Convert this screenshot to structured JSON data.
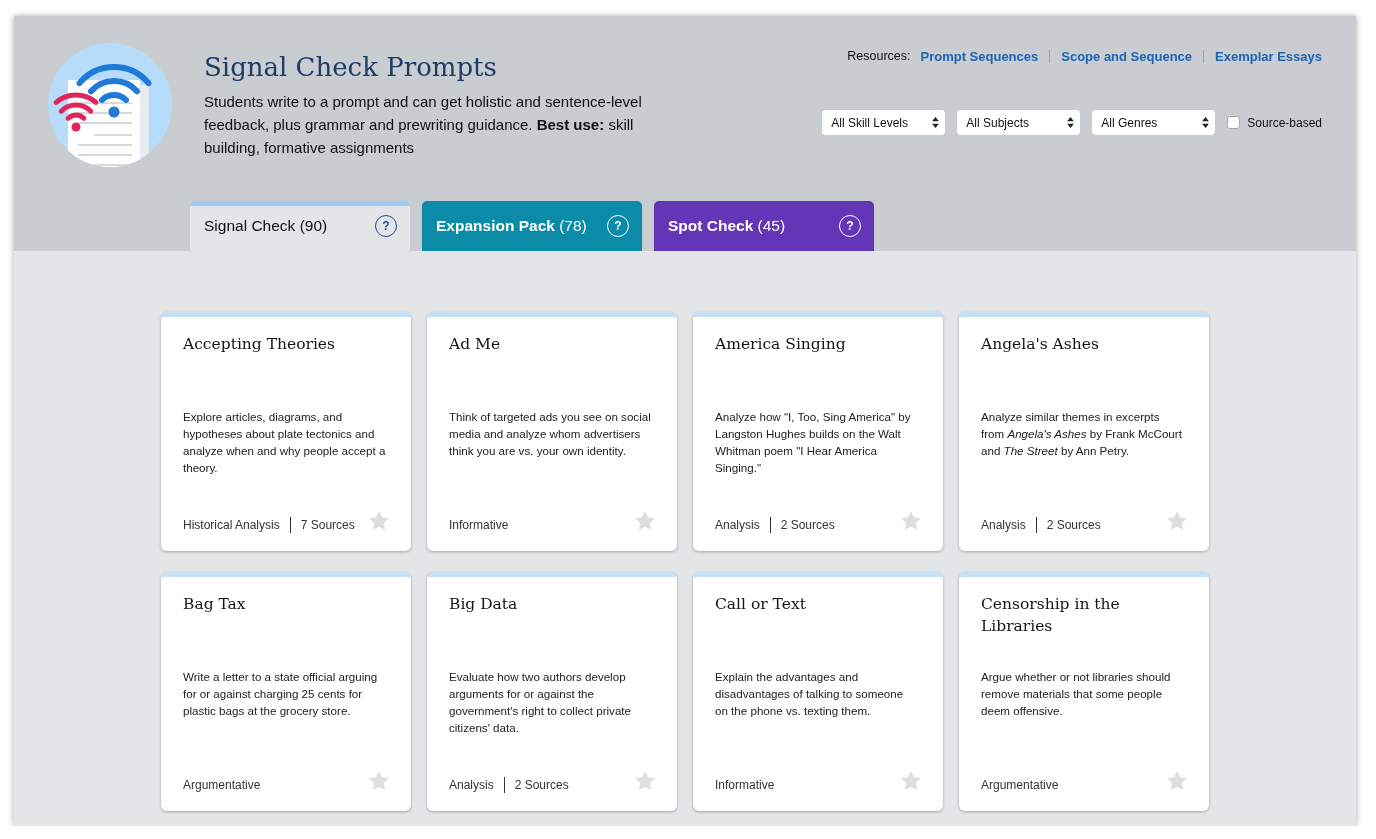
{
  "header": {
    "title": "Signal Check Prompts",
    "description": "Students write to a prompt and can get holistic and sentence-level feedback, plus grammar and prewriting guidance. **Best use:** skill building, formative assignments"
  },
  "resources": {
    "label": "Resources:",
    "links": [
      "Prompt Sequences",
      "Scope and Sequence",
      "Exemplar Essays"
    ]
  },
  "filters": {
    "dropdowns": [
      {
        "value": "All Skill Levels"
      },
      {
        "value": "All Subjects"
      },
      {
        "value": "All Genres"
      }
    ],
    "source_based": {
      "label": "Source-based",
      "checked": false
    }
  },
  "tabs": [
    {
      "label": "Signal Check",
      "count": "(90)",
      "help": "?",
      "selected": true,
      "color": "#9ccdf0"
    },
    {
      "label": "Expansion Pack",
      "count": "(78)",
      "help": "?",
      "selected": false,
      "color": "#0b8ba7"
    },
    {
      "label": "Spot Check",
      "count": "(45)",
      "help": "?",
      "selected": false,
      "color": "#6236b6"
    }
  ],
  "cards": [
    {
      "title": "Accepting Theories",
      "description": "Explore articles, diagrams, and hypotheses about plate tectonics and analyze when and why people accept a theory.",
      "genre": "Historical Analysis",
      "sources": "7 Sources",
      "starred": false
    },
    {
      "title": "Ad Me",
      "description": "Think of targeted ads you see on social media and analyze whom advertisers think you are vs. your own identity.",
      "genre": "Informative",
      "starred": false
    },
    {
      "title": "America Singing",
      "description": "Analyze how \"I, Too, Sing America\" by Langston Hughes builds on the Walt Whitman poem \"I Hear America Singing.\"",
      "genre": "Analysis",
      "sources": "2 Sources",
      "starred": false
    },
    {
      "title": "Angela's Ashes",
      "description": "Analyze similar themes in excerpts from *Angela's Ashes* by Frank McCourt and *The Street* by Ann Petry.",
      "genre": "Analysis",
      "sources": "2 Sources",
      "starred": false
    },
    {
      "title": "Bag Tax",
      "description": "Write a letter to a state official arguing for or against charging 25 cents for plastic bags at the grocery store.",
      "genre": "Argumentative",
      "starred": false
    },
    {
      "title": "Big Data",
      "description": "Evaluate how two authors develop arguments for or against the government's right to collect private citizens' data.",
      "genre": "Analysis",
      "sources": "2 Sources",
      "starred": false
    },
    {
      "title": "Call or Text",
      "description": "Explain the advantages and disadvantages of talking to someone on the phone vs. texting them.",
      "genre": "Informative",
      "starred": false
    },
    {
      "title": "Censorship in the Libraries",
      "description": "Argue whether or not libraries should remove materials that some people deem offensive.",
      "genre": "Argumentative",
      "starred": false
    }
  ]
}
